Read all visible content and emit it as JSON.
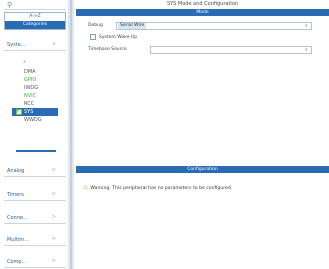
{
  "window": {
    "title": "SYS Mode and Configuration"
  },
  "sidebar": {
    "search_icon": "search-icon",
    "az_label": "A->Z",
    "categories_label": "Categories",
    "system_core": {
      "label": "Syste...",
      "sort_glyph": "∧",
      "items": [
        {
          "label": "DMA",
          "style": "gray"
        },
        {
          "label": "GPIO",
          "style": "green"
        },
        {
          "label": "IWDG",
          "style": "gray"
        },
        {
          "label": "NVIC",
          "style": "green"
        },
        {
          "label": "RCC",
          "style": "gray"
        },
        {
          "label": "SYS",
          "style": "selected",
          "checked": true
        },
        {
          "label": "WWDG",
          "style": "gray"
        }
      ]
    },
    "categories": [
      {
        "label": "Analog"
      },
      {
        "label": "Timers"
      },
      {
        "label": "Conne..."
      },
      {
        "label": "Multim..."
      },
      {
        "label": "Comp..."
      }
    ],
    "chevron_glyph": ">",
    "chevron_down_glyph": "∨"
  },
  "mode": {
    "section_title": "Mode",
    "debug": {
      "label": "Debug",
      "value": "Serial Wire"
    },
    "system_wakeup": {
      "label": "System Wake-Up",
      "checked": false
    },
    "timebase": {
      "label": "Timebase Source",
      "value": ""
    },
    "dropdown_glyph": "∨"
  },
  "configuration": {
    "section_title": "Configuration",
    "warning": "Warning: This peripheral has no parameters to be configured.",
    "warning_glyph": "⚠"
  },
  "colors": {
    "accent": "#2a6cb3",
    "enabled": "#47a448",
    "warning": "#e8a20b"
  }
}
